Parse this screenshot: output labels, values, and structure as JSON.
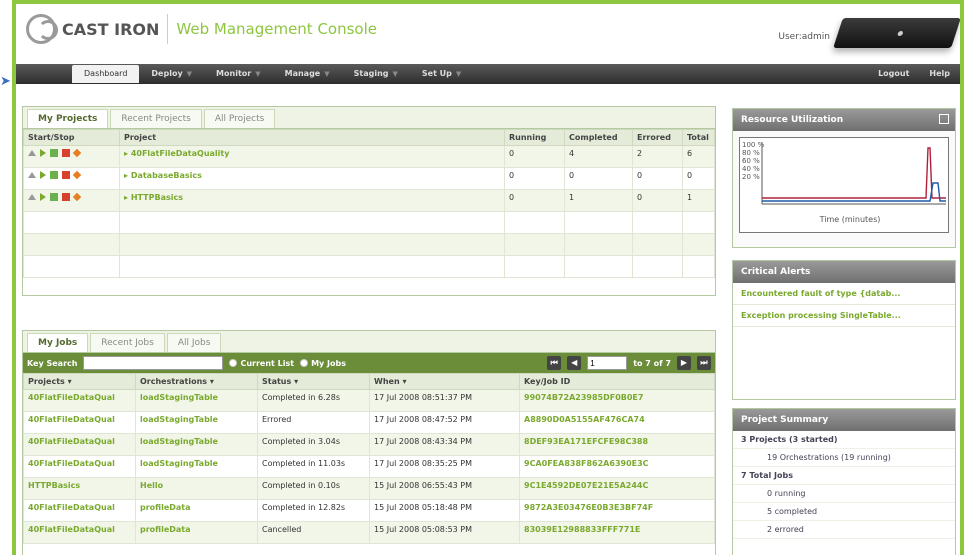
{
  "header": {
    "brand": "CAST IRON",
    "product": "Web Management Console",
    "user_label": "User:admin"
  },
  "nav": {
    "tabs": [
      {
        "label": "Dashboard",
        "active": true
      },
      {
        "label": "Deploy"
      },
      {
        "label": "Monitor"
      },
      {
        "label": "Manage"
      },
      {
        "label": "Staging"
      },
      {
        "label": "Set Up"
      }
    ],
    "right": [
      "Logout",
      "Help"
    ]
  },
  "projects": {
    "tabs": [
      "My Projects",
      "Recent Projects",
      "All Projects"
    ],
    "columns": [
      "Start/Stop",
      "Project",
      "Running",
      "Completed",
      "Errored",
      "Total"
    ],
    "rows": [
      {
        "project": "40FlatFileDataQuality",
        "running": "0",
        "completed": "4",
        "errored": "2",
        "total": "6"
      },
      {
        "project": "DatabaseBasics",
        "running": "0",
        "completed": "0",
        "errored": "0",
        "total": "0"
      },
      {
        "project": "HTTPBasics",
        "running": "0",
        "completed": "1",
        "errored": "0",
        "total": "1"
      }
    ]
  },
  "jobs": {
    "tabs": [
      "My Jobs",
      "Recent Jobs",
      "All Jobs"
    ],
    "toolbar": {
      "key_search": "Key Search",
      "current_list": "Current List",
      "my_jobs": "My Jobs",
      "page": "1",
      "page_range": "to 7 of 7"
    },
    "columns": [
      "Projects",
      "Orchestrations",
      "Status",
      "When",
      "Key/Job ID"
    ],
    "rows": [
      {
        "project": "40FlatFileDataQual",
        "orch": "loadStagingTable",
        "status": "Completed in 6.28s",
        "when": "17 Jul 2008 08:51:37 PM",
        "id": "99074B72A23985DF0B0E7"
      },
      {
        "project": "40FlatFileDataQual",
        "orch": "loadStagingTable",
        "status": "Errored",
        "when": "17 Jul 2008 08:47:52 PM",
        "id": "A8890D0A5155AF476CA74"
      },
      {
        "project": "40FlatFileDataQual",
        "orch": "loadStagingTable",
        "status": "Completed in 3.04s",
        "when": "17 Jul 2008 08:43:34 PM",
        "id": "8DEF93EA171EFCFE98C388"
      },
      {
        "project": "40FlatFileDataQual",
        "orch": "loadStagingTable",
        "status": "Completed in 11.03s",
        "when": "17 Jul 2008 08:35:25 PM",
        "id": "9CA0FEA838F862A6390E3C"
      },
      {
        "project": "HTTPBasics",
        "orch": "Hello",
        "status": "Completed in 0.10s",
        "when": "15 Jul 2008 06:55:43 PM",
        "id": "9C1E4592DE07E21E5A244C"
      },
      {
        "project": "40FlatFileDataQual",
        "orch": "profileData",
        "status": "Completed in 12.82s",
        "when": "15 Jul 2008 05:18:48 PM",
        "id": "9872A3E03476E0B3E3BF74F"
      },
      {
        "project": "40FlatFileDataQual",
        "orch": "profileData",
        "status": "Cancelled",
        "when": "15 Jul 2008 05:08:53 PM",
        "id": "83039E12988833FFF771E"
      }
    ]
  },
  "resource": {
    "title": "Resource Utilization",
    "y_ticks": [
      "100 %",
      "80 %",
      "60 %",
      "40 %",
      "20 %"
    ],
    "x_label": "Time (minutes)"
  },
  "alerts": {
    "title": "Critical Alerts",
    "items": [
      "Encountered fault of type {datab...",
      "Exception processing SingleTable..."
    ]
  },
  "summary": {
    "title": "Project Summary",
    "lines": [
      {
        "text": "3 Projects (3 started)",
        "indent": false
      },
      {
        "text": "19 Orchestrations (19 running)",
        "indent": true
      },
      {
        "text": "7 Total Jobs",
        "indent": false
      },
      {
        "text": "0 running",
        "indent": true
      },
      {
        "text": "5 completed",
        "indent": true
      },
      {
        "text": "2 errored",
        "indent": true
      }
    ]
  }
}
